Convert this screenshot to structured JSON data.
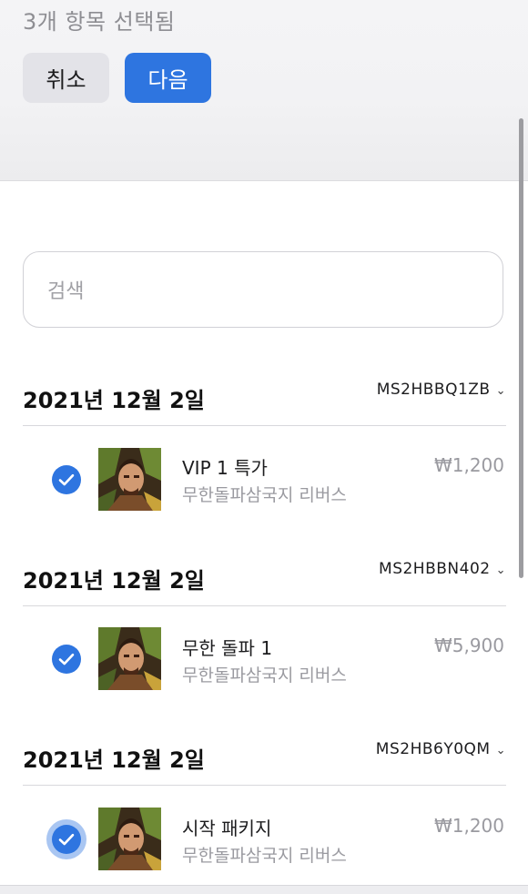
{
  "header": {
    "selected_count": "3개 항목 선택됨",
    "cancel_label": "취소",
    "next_label": "다음",
    "accent": "#2e75e0"
  },
  "search": {
    "placeholder": "검색"
  },
  "groups": [
    {
      "date": "2021년 12월 2일",
      "order_id": "MS2HBBQ1ZB",
      "item": {
        "name": "VIP 1 특가",
        "app": "무한돌파삼국지 리버스",
        "price": "₩1,200",
        "selected": true
      }
    },
    {
      "date": "2021년 12월 2일",
      "order_id": "MS2HBBN402",
      "item": {
        "name": "무한 돌파 1",
        "app": "무한돌파삼국지 리버스",
        "price": "₩5,900",
        "selected": true
      }
    },
    {
      "date": "2021년 12월 2일",
      "order_id": "MS2HB6Y0QM",
      "item": {
        "name": "시작 패키지",
        "app": "무한돌파삼국지 리버스",
        "price": "₩1,200",
        "selected": true
      }
    }
  ]
}
